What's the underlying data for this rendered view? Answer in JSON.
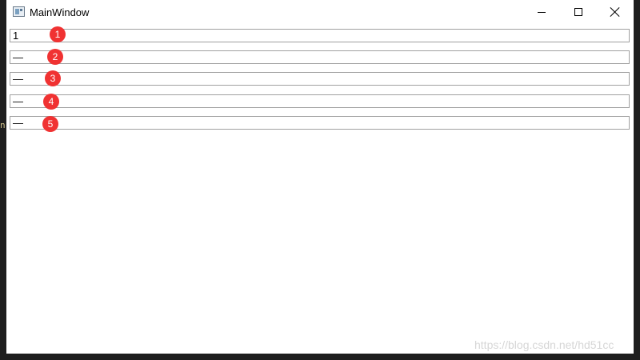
{
  "window": {
    "title": "MainWindow"
  },
  "fields": [
    {
      "value": "1",
      "marker": "1"
    },
    {
      "value": "—",
      "marker": "2"
    },
    {
      "value": "—",
      "marker": "3"
    },
    {
      "value": "—",
      "marker": "4"
    },
    {
      "value": "—",
      "marker": "5"
    }
  ],
  "backdrop_glyph": "n'",
  "watermark": "https://blog.csdn.net/hd51cc",
  "colors": {
    "marker": "#f03232",
    "field_border": "#a0a0a0",
    "desktop": "#1e1e1e"
  },
  "icons": {
    "app": "window-app-icon",
    "minimize": "minimize-icon",
    "maximize": "maximize-icon",
    "close": "close-icon",
    "grip": "drag-grip-icon"
  }
}
